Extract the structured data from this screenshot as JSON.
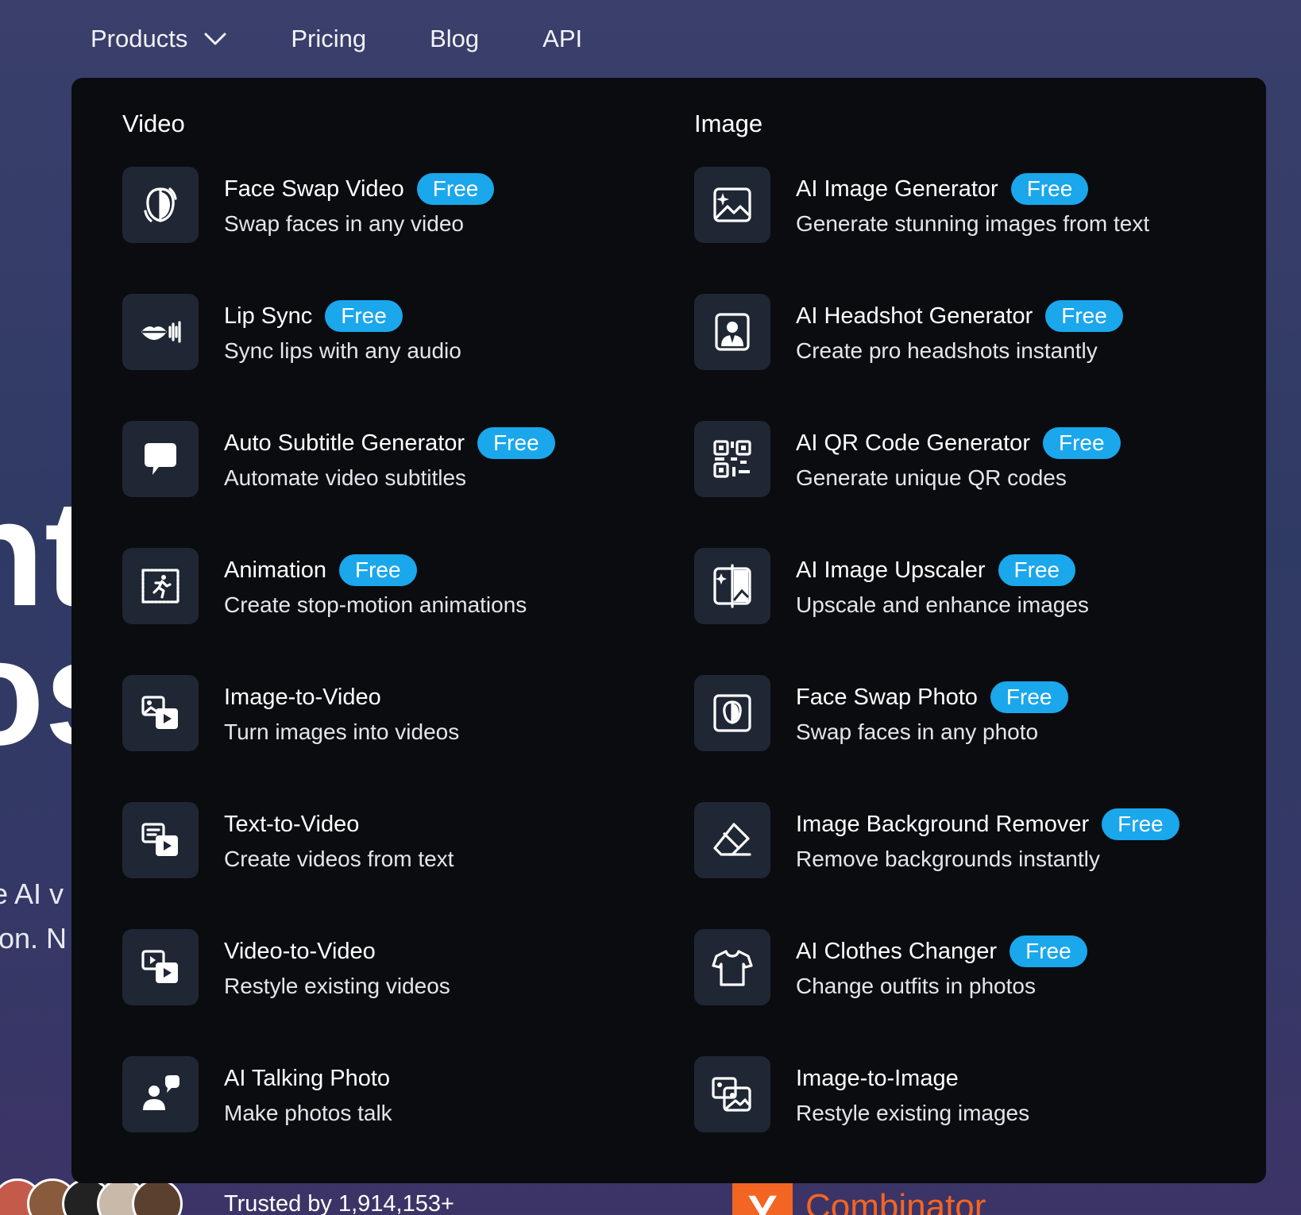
{
  "nav": {
    "items": [
      {
        "label": "Products",
        "has_dropdown": true
      },
      {
        "label": "Pricing"
      },
      {
        "label": "Blog"
      },
      {
        "label": "API"
      }
    ]
  },
  "background": {
    "hero_fragment": "nt\nos",
    "sub_fragment": "e AI v\nion. N",
    "trusted": "Trusted by 1,914,153+",
    "yc_letter": "Y",
    "yc_text": "Combinator"
  },
  "menu": {
    "badge_label": "Free",
    "video": {
      "title": "Video",
      "items": [
        {
          "title": "Face Swap Video",
          "desc": "Swap faces in any video",
          "free": true,
          "icon": "face-swap-icon"
        },
        {
          "title": "Lip Sync",
          "desc": "Sync lips with any audio",
          "free": true,
          "icon": "lips-icon"
        },
        {
          "title": "Auto Subtitle Generator",
          "desc": "Automate video subtitles",
          "free": true,
          "icon": "speech-bubble-icon"
        },
        {
          "title": "Animation",
          "desc": "Create stop-motion animations",
          "free": true,
          "icon": "running-figure-icon"
        },
        {
          "title": "Image-to-Video",
          "desc": "Turn images into videos",
          "free": false,
          "icon": "image-play-icon"
        },
        {
          "title": "Text-to-Video",
          "desc": "Create videos from text",
          "free": false,
          "icon": "text-play-icon"
        },
        {
          "title": "Video-to-Video",
          "desc": "Restyle existing videos",
          "free": false,
          "icon": "video-play-icon"
        },
        {
          "title": "AI Talking Photo",
          "desc": "Make photos talk",
          "free": false,
          "icon": "talking-person-icon"
        }
      ]
    },
    "image": {
      "title": "Image",
      "items": [
        {
          "title": "AI Image Generator",
          "desc": "Generate stunning images from text",
          "free": true,
          "icon": "image-sparkle-icon"
        },
        {
          "title": "AI Headshot Generator",
          "desc": "Create pro headshots instantly",
          "free": true,
          "icon": "headshot-icon"
        },
        {
          "title": "AI QR Code Generator",
          "desc": "Generate unique QR codes",
          "free": true,
          "icon": "qr-code-icon"
        },
        {
          "title": "AI Image Upscaler",
          "desc": "Upscale and enhance images",
          "free": true,
          "icon": "upscale-icon"
        },
        {
          "title": "Face Swap Photo",
          "desc": "Swap faces in any photo",
          "free": true,
          "icon": "face-swap-photo-icon"
        },
        {
          "title": "Image Background Remover",
          "desc": "Remove backgrounds instantly",
          "free": true,
          "icon": "eraser-icon"
        },
        {
          "title": "AI Clothes Changer",
          "desc": "Change outfits in photos",
          "free": true,
          "icon": "tshirt-icon"
        },
        {
          "title": "Image-to-Image",
          "desc": "Restyle existing images",
          "free": false,
          "icon": "images-icon"
        }
      ]
    }
  },
  "colors": {
    "panel_bg": "#0b0c0f",
    "icon_bg": "#1f2634",
    "badge_bg": "#1aa7ec",
    "yc_orange": "#f26522"
  }
}
